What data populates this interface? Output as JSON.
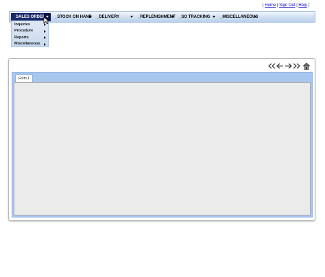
{
  "toplinks": {
    "sep_open": "|",
    "home": "Home",
    "sep1": "|",
    "signout": "Sign Out",
    "sep2": "|",
    "help": "Help",
    "sep_close": "|"
  },
  "menubar": {
    "items": [
      {
        "label": "SALES ORDER"
      },
      {
        "label": "_STOCK ON HAND"
      },
      {
        "label": "_DELIVERY"
      },
      {
        "label": "_REPLENISHMENT"
      },
      {
        "label": "_SO TRACKING"
      },
      {
        "label": "_MISCELLANEOUS"
      }
    ],
    "active_index": 0,
    "active_color": "#1b2a6b"
  },
  "dropdown": {
    "items": [
      {
        "label": "Inquiries"
      },
      {
        "label": "Procedure"
      },
      {
        "label": "Reports"
      },
      {
        "label": "Miscellaneous"
      }
    ]
  },
  "navigation": {
    "icons": [
      "first-record-icon",
      "previous-record-icon",
      "next-record-icon",
      "last-record-icon",
      "home-icon"
    ]
  },
  "form": {
    "tab_label": "Form 1",
    "frame_color": "#a9c6ee",
    "content_color": "#ebebeb"
  }
}
